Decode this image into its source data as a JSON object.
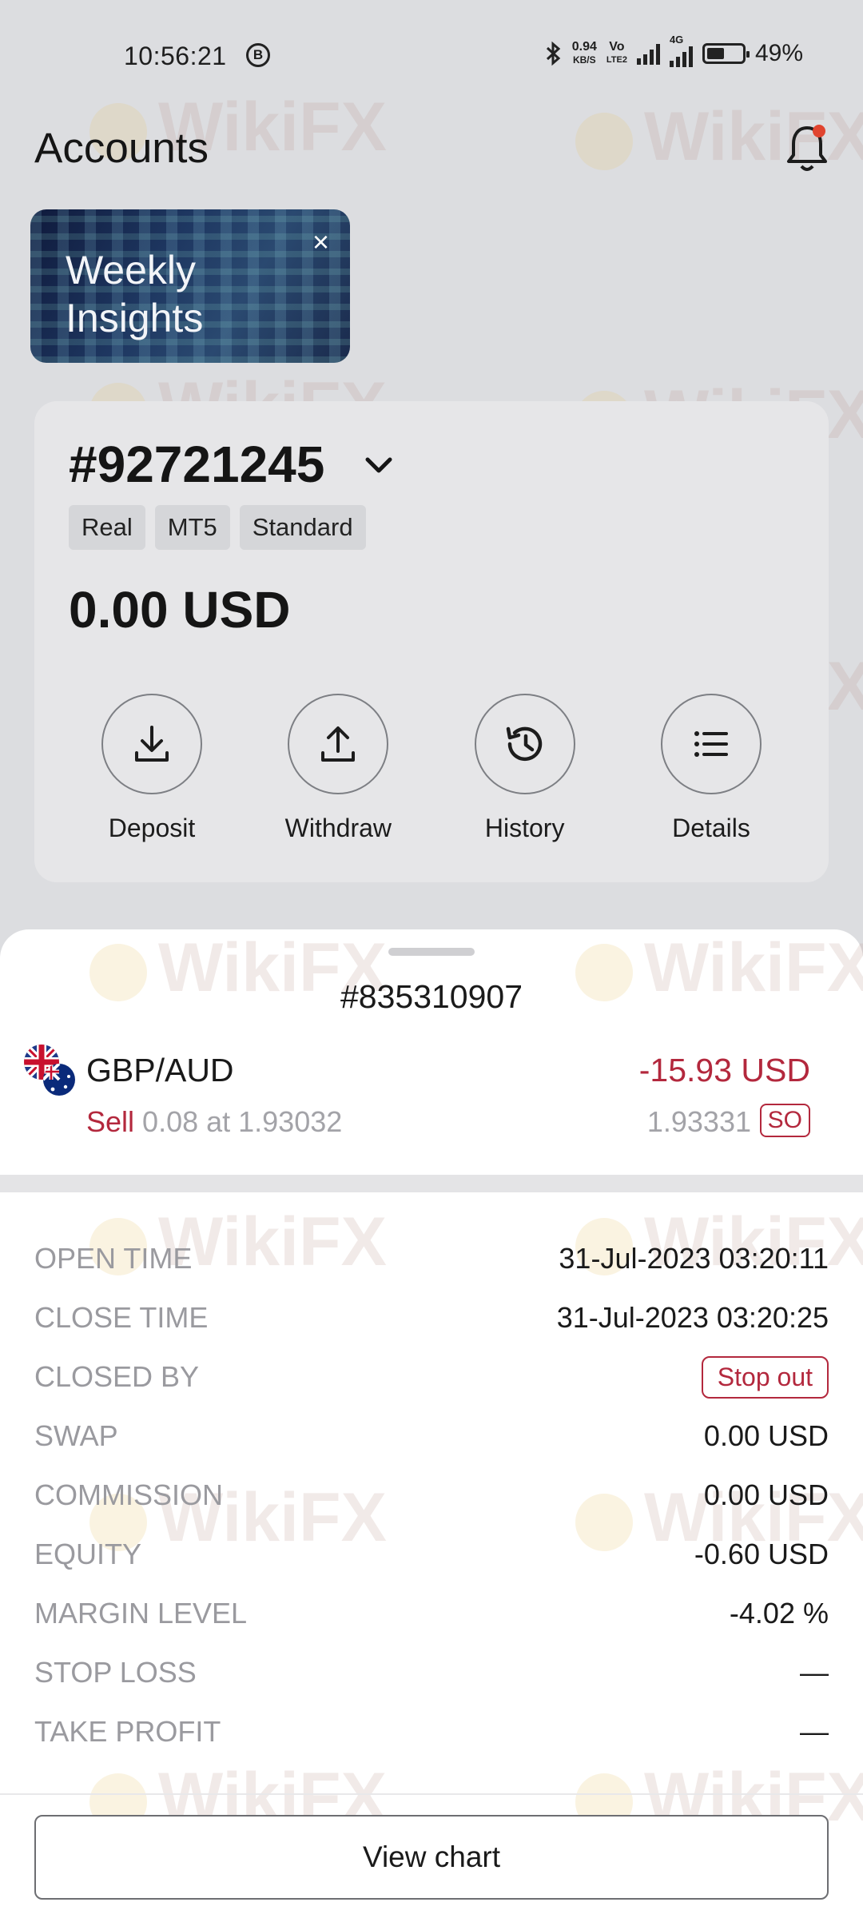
{
  "status_bar": {
    "time": "10:56:21",
    "b_badge": "B",
    "speed_value": "0.94",
    "speed_unit": "KB/S",
    "volte_top": "Vo",
    "volte_bottom": "LTE2",
    "net_type": "4G",
    "battery_percent": "49%",
    "battery_level": 0.49
  },
  "header": {
    "title": "Accounts"
  },
  "banner": {
    "text_line1": "Weekly",
    "text_line2": "Insights"
  },
  "account": {
    "number": "#92721245",
    "tags": [
      "Real",
      "MT5",
      "Standard"
    ],
    "balance": "0.00 USD",
    "actions": [
      {
        "label": "Deposit",
        "icon": "download-icon"
      },
      {
        "label": "Withdraw",
        "icon": "upload-icon"
      },
      {
        "label": "History",
        "icon": "history-icon"
      },
      {
        "label": "Details",
        "icon": "list-icon"
      }
    ]
  },
  "position": {
    "order_id": "#835310907",
    "symbol": "GBP/AUD",
    "pnl": "-15.93 USD",
    "side": "Sell",
    "volume_price": "0.08 at 1.93032",
    "current_price": "1.93331",
    "badge": "SO"
  },
  "details": [
    {
      "key": "OPEN TIME",
      "value": "31-Jul-2023 03:20:11"
    },
    {
      "key": "CLOSE TIME",
      "value": "31-Jul-2023 03:20:25"
    },
    {
      "key": "CLOSED BY",
      "value": "Stop out"
    },
    {
      "key": "SWAP",
      "value": "0.00 USD"
    },
    {
      "key": "COMMISSION",
      "value": "0.00 USD"
    },
    {
      "key": "EQUITY",
      "value": "-0.60 USD"
    },
    {
      "key": "MARGIN LEVEL",
      "value": "-4.02 %"
    },
    {
      "key": "STOP LOSS",
      "value": "—"
    },
    {
      "key": "TAKE PROFIT",
      "value": "—"
    }
  ],
  "view_chart_label": "View chart",
  "watermark": "WikiFX",
  "colors": {
    "loss_red": "#b3283d",
    "background": "#dcdde0",
    "card": "#e6e6e8",
    "notification_dot": "#e0442f"
  }
}
